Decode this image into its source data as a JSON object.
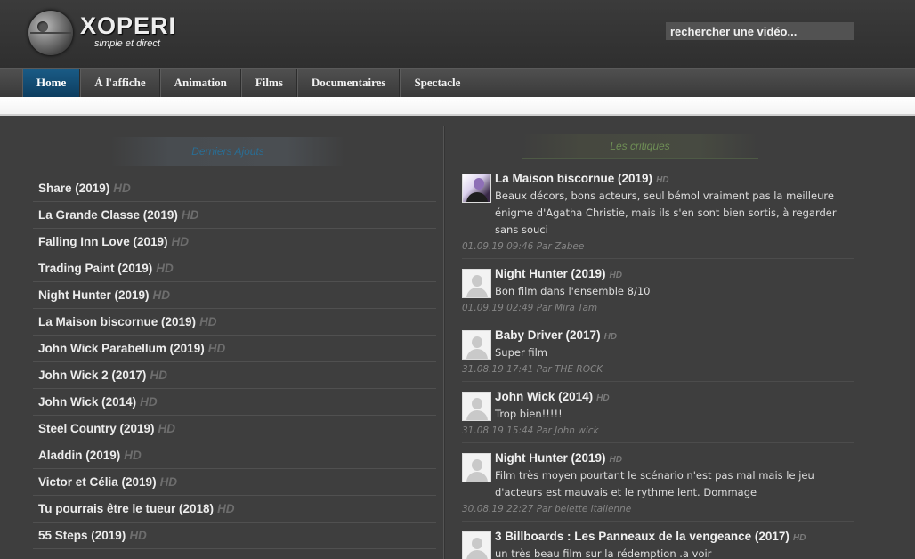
{
  "header": {
    "logo_title": "XOPERI",
    "logo_subtitle": "simple et direct",
    "search_placeholder": "rechercher une vidéo..."
  },
  "nav": {
    "items": [
      "Home",
      "À l'affiche",
      "Animation",
      "Films",
      "Documentaires",
      "Spectacle"
    ],
    "active_index": 0
  },
  "latest": {
    "title": "Derniers Ajouts",
    "items": [
      {
        "title": "Share (2019)",
        "badge": "HD"
      },
      {
        "title": "La Grande Classe (2019)",
        "badge": "HD"
      },
      {
        "title": "Falling Inn Love (2019)",
        "badge": "HD"
      },
      {
        "title": "Trading Paint (2019)",
        "badge": "HD"
      },
      {
        "title": "Night Hunter (2019)",
        "badge": "HD"
      },
      {
        "title": "La Maison biscornue (2019)",
        "badge": "HD"
      },
      {
        "title": "John Wick Parabellum (2019)",
        "badge": "HD"
      },
      {
        "title": "John Wick 2 (2017)",
        "badge": "HD"
      },
      {
        "title": "John Wick (2014)",
        "badge": "HD"
      },
      {
        "title": "Steel Country (2019)",
        "badge": "HD"
      },
      {
        "title": "Aladdin (2019)",
        "badge": "HD"
      },
      {
        "title": "Victor et Célia (2019)",
        "badge": "HD"
      },
      {
        "title": "Tu pourrais être le tueur (2018)",
        "badge": "HD"
      },
      {
        "title": "55 Steps (2019)",
        "badge": "HD"
      }
    ]
  },
  "reviews": {
    "title": "Les critiques",
    "items": [
      {
        "title": "La Maison biscornue (2019)",
        "badge": "HD",
        "avatar": "photo",
        "text": "Beaux décors, bons acteurs, seul bémol vraiment pas la meilleure énigme d'Agatha Christie, mais ils s'en sont bien sortis, à regarder sans souci",
        "meta": "01.09.19 09:46 Par Zabee"
      },
      {
        "title": "Night Hunter (2019)",
        "badge": "HD",
        "avatar": "default",
        "text": "Bon film dans l'ensemble 8/10",
        "meta": "01.09.19 02:49 Par Mira Tam"
      },
      {
        "title": "Baby Driver (2017)",
        "badge": "HD",
        "avatar": "default",
        "text": "Super film",
        "meta": "31.08.19 17:41 Par THE ROCK"
      },
      {
        "title": "John Wick (2014)",
        "badge": "HD",
        "avatar": "default",
        "text": "Trop bien!!!!!",
        "meta": "31.08.19 15:44 Par John wick"
      },
      {
        "title": "Night Hunter (2019)",
        "badge": "HD",
        "avatar": "default",
        "text": "Film très moyen pourtant le scénario n'est pas mal mais le jeu d'acteurs est mauvais et le rythme lent. Dommage",
        "meta": "30.08.19 22:27 Par belette italienne"
      },
      {
        "title": "3 Billboards : Les Panneaux de la vengeance (2017)",
        "badge": "HD",
        "avatar": "default",
        "text": "un très beau film sur la rédemption .a voir",
        "meta": ""
      }
    ]
  }
}
